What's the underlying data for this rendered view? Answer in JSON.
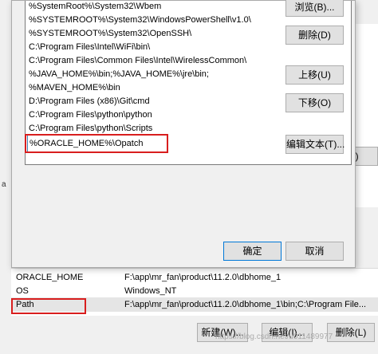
{
  "background": {
    "right_partial_button": "D)",
    "side_mark": "a",
    "system_variables": [
      {
        "name": "ORACLE_HOME",
        "value": "F:\\app\\mr_fan\\product\\11.2.0\\dbhome_1"
      },
      {
        "name": "OS",
        "value": "Windows_NT"
      },
      {
        "name": "Path",
        "value": "F:\\app\\mr_fan\\product\\11.2.0\\dbhome_1\\bin;C:\\Program File..."
      }
    ],
    "buttons": {
      "new": "新建(W)...",
      "edit": "编辑(I)...",
      "delete": "删除(L)"
    }
  },
  "dialog": {
    "path_entries": [
      "%SystemRoot%\\System32\\Wbem",
      "%SYSTEMROOT%\\System32\\WindowsPowerShell\\v1.0\\",
      "%SYSTEMROOT%\\System32\\OpenSSH\\",
      "C:\\Program Files\\Intel\\WiFi\\bin\\",
      "C:\\Program Files\\Common Files\\Intel\\WirelessCommon\\",
      "%JAVA_HOME%\\bin;%JAVA_HOME%\\jre\\bin;",
      "%MAVEN_HOME%\\bin",
      "D:\\Program Files (x86)\\Git\\cmd",
      "C:\\Program Files\\python\\python",
      "C:\\Program Files\\python\\Scripts"
    ],
    "editing_entry": "%ORACLE_HOME%\\Opatch",
    "side_buttons": {
      "browse": "浏览(B)...",
      "delete": "删除(D)",
      "move_up": "上移(U)",
      "move_down": "下移(O)",
      "edit_text": "编辑文本(T)..."
    },
    "ok": "确定",
    "cancel": "取消"
  },
  "watermark": "https://blog.csdn.net/u011489977",
  "colors": {
    "highlight_box": "#d81e1e",
    "focus_border": "#0078d7"
  }
}
